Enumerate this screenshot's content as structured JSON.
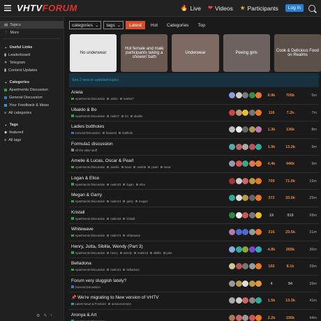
{
  "header": {
    "logo_main": "VHTV",
    "logo_accent": "FORUM",
    "nav": [
      {
        "icon": "fire-icon",
        "glyph": "🔥",
        "label": "Live"
      },
      {
        "icon": "heart-icon",
        "glyph": "❤",
        "label": "Videos"
      },
      {
        "icon": "star-icon",
        "glyph": "★",
        "label": "Participants"
      }
    ],
    "login_label": "Log In"
  },
  "sidebar": {
    "top_items": [
      {
        "label": "Topics",
        "icon": "topics-icon",
        "glyph": "▤",
        "active": true
      },
      {
        "label": "More",
        "icon": "more-icon",
        "glyph": "⋮",
        "active": false
      }
    ],
    "useful_links_heading": "Useful Links",
    "useful_links": [
      {
        "label": "Leaderboard",
        "icon": "leaderboard-icon",
        "glyph": "▮"
      },
      {
        "label": "Telegram",
        "icon": "telegram-icon",
        "glyph": "✈"
      },
      {
        "label": "Content Updates",
        "icon": "updates-icon",
        "glyph": "▮"
      }
    ],
    "categories_heading": "Categories",
    "categories": [
      {
        "label": "Apartments Discussion",
        "color": "#1fa84f"
      },
      {
        "label": "General Discussion",
        "color": "#2a7fd4"
      },
      {
        "label": "Your Feedback & Ideas",
        "color": "#2e9dc7"
      },
      {
        "label": "All categories",
        "color": ""
      }
    ],
    "tags_heading": "Tags",
    "tags": [
      {
        "label": "featured",
        "icon": "tag-icon"
      },
      {
        "label": "All tags",
        "icon": "tags-list-icon"
      }
    ]
  },
  "filters": {
    "categories_label": "categories",
    "tags_label": "tags",
    "tabs": [
      "Latest",
      "Hot",
      "Categories",
      "Top"
    ],
    "active_tab": "Latest"
  },
  "banners": [
    {
      "label": "No underwear",
      "color": "#e6e6e6",
      "text_color": "#222"
    },
    {
      "label": "Hot female and male participants taking a shower/ bath",
      "color": "#6a5a52",
      "text_color": "#fff"
    },
    {
      "label": "Underwear",
      "color": "#7c6a63",
      "text_color": "#fff"
    },
    {
      "label": "Peeing girls",
      "color": "#6b6360",
      "text_color": "#fff"
    },
    {
      "label": "Cook & Delicious Food on Realms",
      "color": "#5a5249",
      "text_color": "#fff"
    }
  ],
  "updated_notice": "See 2 new or updated topics",
  "topics": [
    {
      "title": "Ariela",
      "category": "Apartments Discussion",
      "cat_color": "#1fa84f",
      "tags": [
        "ariela",
        "realm37"
      ],
      "replies": "6.9k",
      "views": "705k",
      "activity": "5m",
      "reply_color": "#e88a3a",
      "view_color": "#e88a3a",
      "avatars": [
        "#8a9ce0",
        "#ccc",
        "#7a7a7a",
        "#3a8a4a",
        "#e87a2a"
      ]
    },
    {
      "title": "Ubaldo & Bo",
      "category": "Apartments Discussion",
      "cat_color": "#1fa84f",
      "tags": [
        "realm7",
        "bo",
        "ubaldo"
      ],
      "replies": "116",
      "views": "7.2k",
      "activity": "7m",
      "reply_color": "#e88a3a",
      "view_color": "#e88a3a",
      "avatars": [
        "#c44",
        "#b97",
        "#e8c02a",
        "#777",
        "#e87a2a"
      ]
    },
    {
      "title": "Ladies buttholes",
      "category": "General Discussion",
      "cat_color": "#2a7fd4",
      "tags": [
        "featured",
        "butthole"
      ],
      "replies": "1.3k",
      "views": "136k",
      "activity": "8m",
      "reply_color": "#e88a3a",
      "view_color": "#e88a3a",
      "avatars": [
        "#bbb",
        "#eee",
        "#666",
        "#a95",
        "#c7a"
      ]
    },
    {
      "title": "Formula1 discussion",
      "category": "All the other stuff",
      "cat_color": "#888",
      "tags": [],
      "replies": "1.9k",
      "views": "13.2k",
      "activity": "9m",
      "reply_color": "#e88a3a",
      "view_color": "#e88a3a",
      "avatars": [
        "#5aa",
        "#b66",
        "#aaa",
        "#b55",
        "#3a9"
      ]
    },
    {
      "title": "Amelie & Lucas, Oscar & Pearl",
      "category": "Apartments Discussion",
      "cat_color": "#1fa84f",
      "tags": [
        "amelie",
        "lucas",
        "realm8",
        "pearl",
        "oscar"
      ],
      "replies": "4.4k",
      "views": "446k",
      "activity": "9m",
      "reply_color": "#e88a3a",
      "view_color": "#e88a3a",
      "avatars": [
        "#99a",
        "#d55",
        "#3a8",
        "#d75",
        "#e87a2a"
      ]
    },
    {
      "title": "Logan & Elice",
      "category": "Apartments Discussion",
      "cat_color": "#1fa84f",
      "tags": [
        "realm22",
        "logan",
        "elice"
      ],
      "replies": "709",
      "views": "71.0k",
      "activity": "16m",
      "reply_color": "#e88a3a",
      "view_color": "#e88a3a",
      "avatars": [
        "#a33",
        "#ccc",
        "#c66",
        "#b94",
        "#e87a2a"
      ]
    },
    {
      "title": "Megan & Garry",
      "category": "Apartments Discussion",
      "cat_color": "#1fa84f",
      "tags": [
        "realm12",
        "garry",
        "megan"
      ],
      "replies": "372",
      "views": "33.0k",
      "activity": "25m",
      "reply_color": "#e88a3a",
      "view_color": "#e88a3a",
      "avatars": [
        "#3a9",
        "#ddd",
        "#b94",
        "#666",
        "#e87a2a"
      ]
    },
    {
      "title": "Kristall",
      "category": "Apartments Discussion",
      "cat_color": "#1fa84f",
      "tags": [
        "realm33",
        "kristall"
      ],
      "replies": "19",
      "views": "919",
      "activity": "28m",
      "reply_color": "#aaa",
      "view_color": "#aaa",
      "avatars": [
        "#2a8a4a",
        "#eee",
        "#c55",
        "#777",
        "#e8c02a"
      ]
    },
    {
      "title": "Whitewave",
      "category": "Apartments Discussion",
      "cat_color": "#1fa84f",
      "tags": [
        "realm74",
        "whitewave"
      ],
      "replies": "316",
      "views": "23.5k",
      "activity": "31m",
      "reply_color": "#e88a3a",
      "view_color": "#e88a3a",
      "avatars": [
        "#b7a",
        "#4a6ad4",
        "#4a6ad4",
        "#999",
        "#e87a2a"
      ]
    },
    {
      "title": "Henry, Jutta, Sibilla, Wendy (Part 3)",
      "category": "Apartments Discussion",
      "cat_color": "#1fa84f",
      "tags": [
        "henry",
        "wendy",
        "realm18",
        "sibilla",
        "jutta"
      ],
      "replies": "4.8k",
      "views": "265k",
      "activity": "36m",
      "reply_color": "#e88a3a",
      "view_color": "#e88a3a",
      "avatars": [
        "#8ad",
        "#3a9",
        "#8a3",
        "#7a4ad4",
        "#3ab"
      ]
    },
    {
      "title": "Belladona",
      "category": "Apartments Discussion",
      "cat_color": "#1fa84f",
      "tags": [
        "realm21",
        "belladona"
      ],
      "replies": "102",
      "views": "8.1k",
      "activity": "39m",
      "reply_color": "#e88a3a",
      "view_color": "#e88a3a",
      "avatars": [
        "#cc8",
        "#b55",
        "#777",
        "#999",
        "#e87a2a"
      ]
    },
    {
      "title": "Forum very sluggish lately?",
      "category": "General Discussion",
      "cat_color": "#2a7fd4",
      "tags": [],
      "replies": "4",
      "views": "94",
      "activity": "39m",
      "reply_color": "#aaa",
      "view_color": "#aaa",
      "avatars": [
        "#999",
        "#b95",
        "#ddd",
        "#b94",
        "#d94"
      ]
    },
    {
      "title": "We're migrating to New version of VHTV",
      "category": "Latest News & Freebies",
      "cat_color": "#2e9dc7",
      "tags": [
        "announcement"
      ],
      "replies": "1.5k",
      "views": "13.3k",
      "activity": "41m",
      "reply_color": "#e88a3a",
      "view_color": "#e88a3a",
      "avatars": [
        "#aaa",
        "#ccc",
        "#c66",
        "#888",
        "#3a9"
      ],
      "pinned": true
    },
    {
      "title": "Aronya & Art",
      "category": "Apartments Discussion",
      "cat_color": "#1fa84f",
      "tags": [],
      "replies": "2.2k",
      "views": "195k",
      "activity": "44m",
      "reply_color": "#e88a3a",
      "view_color": "#e88a3a",
      "avatars": [
        "#a75",
        "#c66",
        "#999",
        "#c55",
        "#e87a2a"
      ]
    }
  ]
}
